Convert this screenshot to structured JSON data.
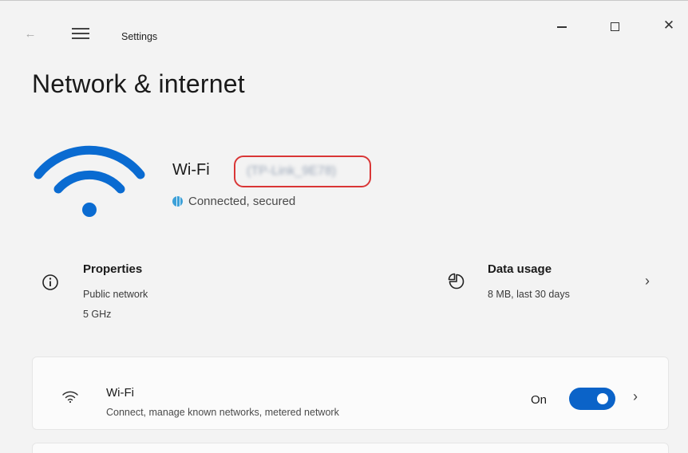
{
  "window": {
    "back_glyph": "←",
    "app_title": "Settings",
    "close_glyph": "✕"
  },
  "page": {
    "title": "Network & internet"
  },
  "hero": {
    "connection_name": "Wi-Fi",
    "ssid": "(TP-Link_9E78)",
    "status": "Connected, secured",
    "highlight_color": "#d93636"
  },
  "properties": {
    "title": "Properties",
    "network_type": "Public network",
    "band": "5 GHz"
  },
  "data_usage": {
    "title": "Data usage",
    "summary": "8 MB, last 30 days",
    "chevron": "›"
  },
  "wifi_card": {
    "title": "Wi-Fi",
    "subtitle": "Connect, manage known networks, metered network",
    "toggle_label": "On",
    "toggle_on": true,
    "accent_color": "#0b63c8",
    "chevron": "›"
  }
}
